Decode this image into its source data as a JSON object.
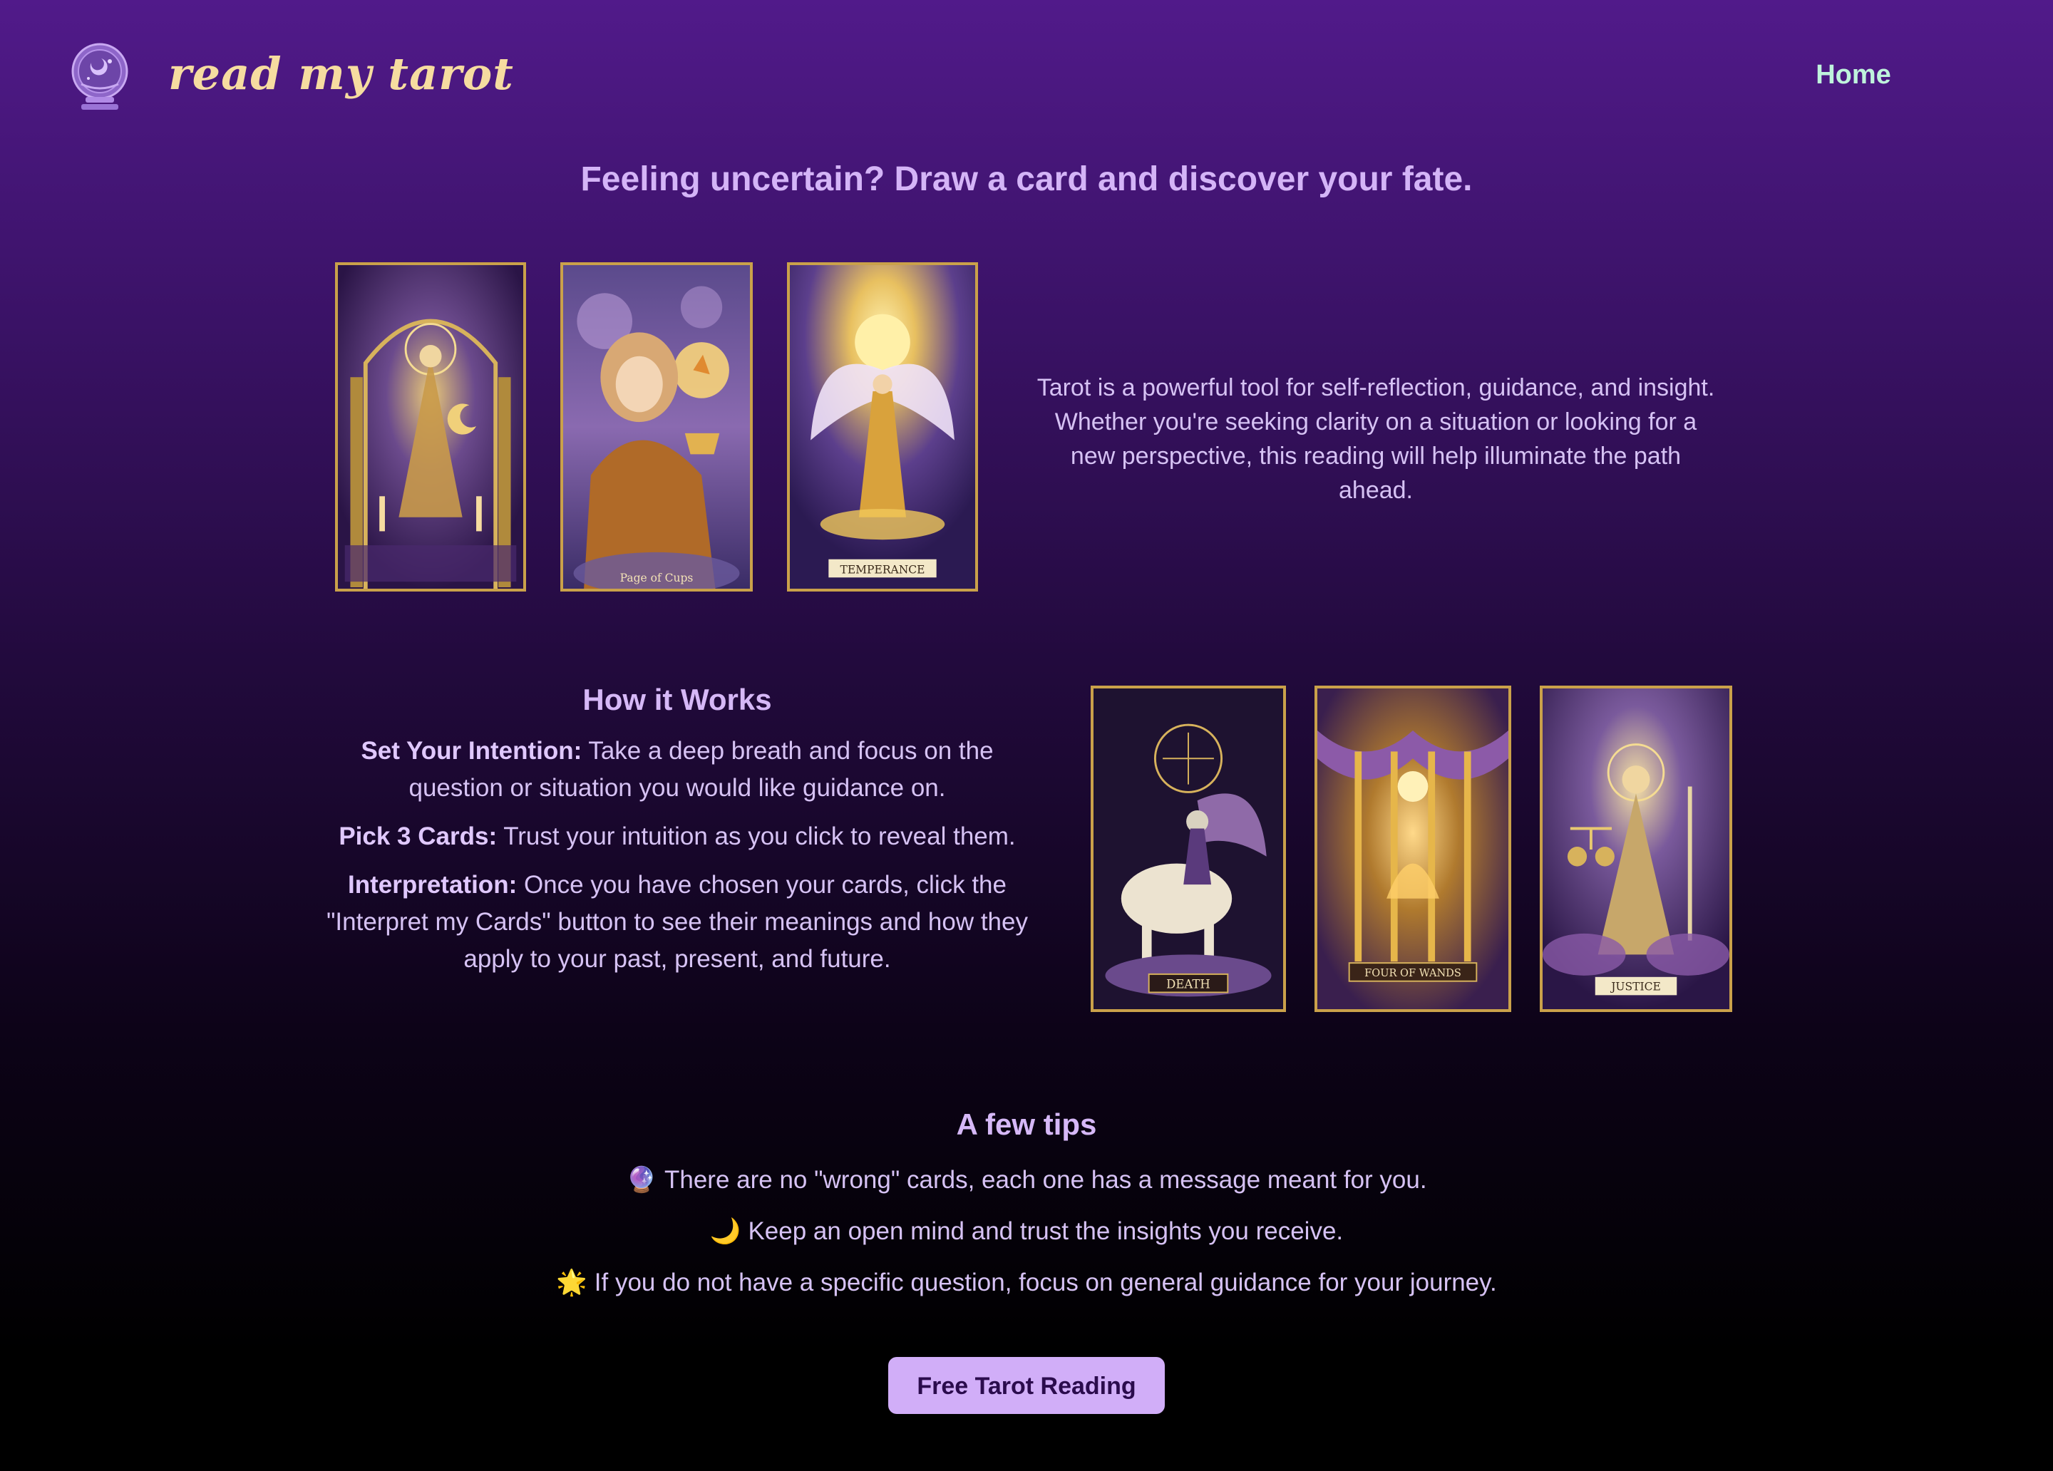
{
  "header": {
    "brand": "read my tarot",
    "logo_icon": "crystal-ball-icon",
    "nav": {
      "home": "Home"
    }
  },
  "hero": {
    "tagline": "Feeling uncertain? Draw a card and discover your fate.",
    "cards": [
      {
        "name": "high-priestess-card",
        "label": ""
      },
      {
        "name": "page-of-cups-card",
        "label": "Page of Cups"
      },
      {
        "name": "temperance-card",
        "label": "TEMPERANCE"
      }
    ],
    "intro": "Tarot is a powerful tool for self-reflection, guidance, and insight. Whether you're seeking clarity on a situation or looking for a new perspective, this reading will help illuminate the path ahead."
  },
  "how_it_works": {
    "title": "How it Works",
    "steps": [
      {
        "label": "Set Your Intention:",
        "text": " Take a deep breath and focus on the question or situation you would like guidance on."
      },
      {
        "label": "Pick 3 Cards:",
        "text": " Trust your intuition as you click to reveal them."
      },
      {
        "label": "Interpretation:",
        "text": " Once you have chosen your cards, click the \"Interpret my Cards\" button to see their meanings and how they apply to your past, present, and future."
      }
    ],
    "cards": [
      {
        "name": "death-card",
        "label": "DEATH"
      },
      {
        "name": "four-of-wands-card",
        "label": "FOUR OF WANDS"
      },
      {
        "name": "justice-card",
        "label": "JUSTICE"
      }
    ]
  },
  "tips": {
    "title": "A few tips",
    "items": [
      {
        "emoji": "🔮",
        "text": "There are no \"wrong\" cards, each one has a message meant for you."
      },
      {
        "emoji": "🌙",
        "text": "Keep an open mind and trust the insights you receive."
      },
      {
        "emoji": "🌟",
        "text": "If you do not have a specific question, focus on general guidance for your journey."
      }
    ]
  },
  "cta": {
    "label": "Free Tarot Reading"
  },
  "colors": {
    "brand": "#f6dca0",
    "nav": "#bff3dc",
    "heading": "#d4b4f7",
    "button": "#d1aef8",
    "card_border": "#caa14a"
  }
}
